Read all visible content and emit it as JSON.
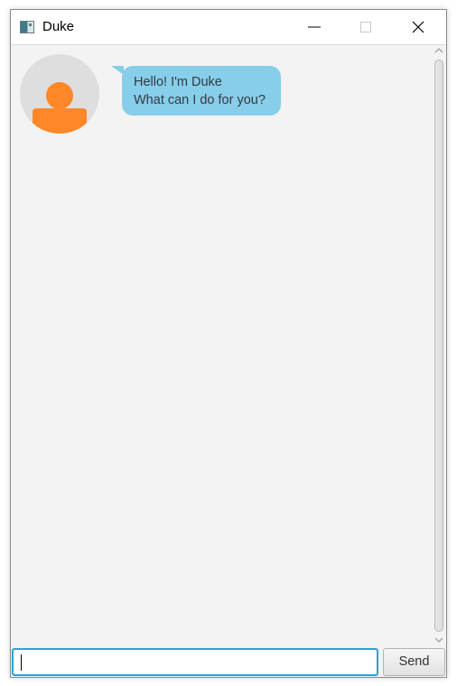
{
  "window": {
    "title": "Duke",
    "controls": [
      "minimize-icon",
      "maximize-icon",
      "close-icon"
    ]
  },
  "chat": {
    "messages": [
      {
        "sender": "Duke",
        "avatar_icon": "user-avatar-icon",
        "lines": [
          "Hello! I'm Duke",
          "What can I do for you?"
        ]
      }
    ]
  },
  "input": {
    "value": "",
    "placeholder": ""
  },
  "send_button": {
    "label": "Send"
  },
  "colors": {
    "bubble": "#87ceeb",
    "avatar_figure": "#ff8727",
    "avatar_bg": "#dedede",
    "input_focus": "#2aa1d8",
    "chat_bg": "#f3f3f3"
  }
}
